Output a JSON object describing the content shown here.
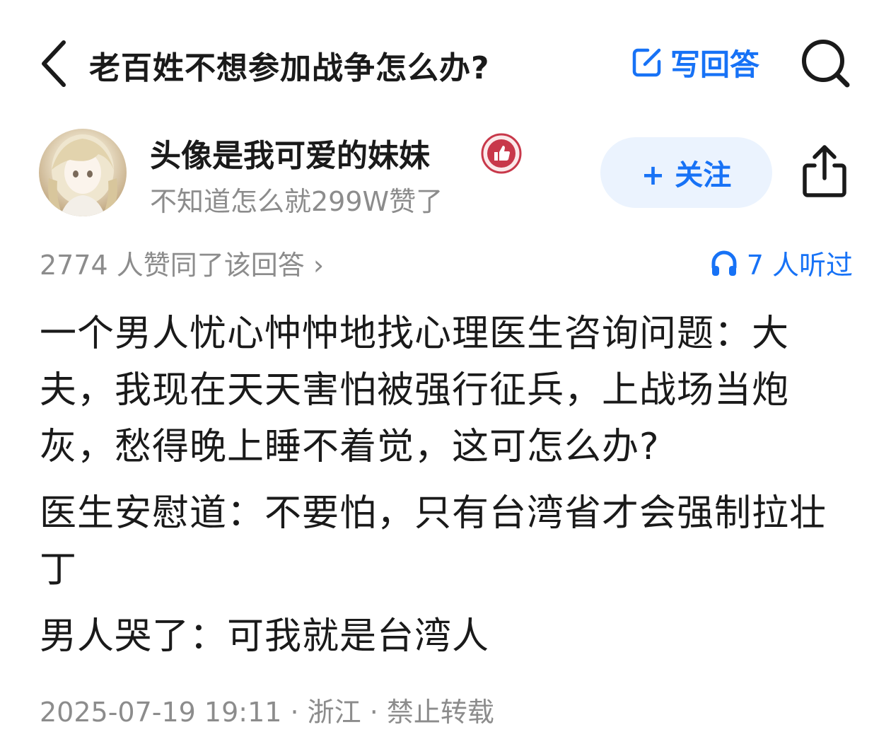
{
  "header": {
    "title": "老百姓不想参加战争怎么办?",
    "write_answer_label": "写回答",
    "back_icon": "chevron-left-icon",
    "write_icon": "edit-icon",
    "search_icon": "search-icon"
  },
  "author": {
    "name": "头像是我可爱的妹妹",
    "bio": "不知道怎么就299W赞了",
    "follow_label": "+ 关注",
    "badge_icon": "thumbs-up-badge-icon",
    "share_icon": "share-icon"
  },
  "meta": {
    "upvote_summary": "2774 人赞同了该回答 ›",
    "listeners": "7 人听过",
    "listen_icon": "headphones-icon"
  },
  "content": {
    "paragraphs": [
      "一个男人忧心忡忡地找心理医生咨询问题：大夫，我现在天天害怕被强行征兵，上战场当炮灰，愁得晚上睡不着觉，这可怎么办?",
      "医生安慰道：不要怕，只有台湾省才会强制拉壮丁",
      "男人哭了：可我就是台湾人"
    ]
  },
  "footer": {
    "info": "2025-07-19 19:11 · 浙江 · 禁止转载"
  },
  "colors": {
    "accent": "#1772f6",
    "text": "#1a1a1a",
    "muted": "#8c8c8c",
    "follow_bg": "#ebf3fe",
    "badge": "#c8384a"
  }
}
